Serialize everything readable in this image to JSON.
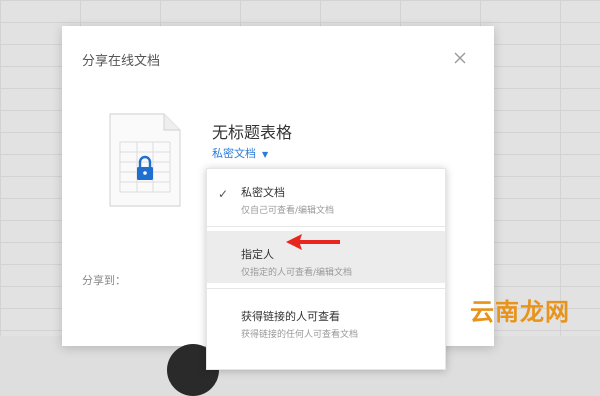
{
  "dialog": {
    "title": "分享在线文档",
    "doc_name": "无标题表格",
    "privacy_selected": "私密文档",
    "share_to_label": "分享到："
  },
  "dropdown": {
    "options": [
      {
        "label": "私密文档",
        "desc": "仅自己可查看/编辑文档",
        "checked": true
      },
      {
        "label": "指定人",
        "desc": "仅指定的人可查看/编辑文档",
        "highlighted": true
      },
      {
        "label": "获得链接的人可查看",
        "desc": "获得链接的任何人可查看文档"
      }
    ]
  },
  "annotation": {
    "arrow_color": "#e8251f"
  },
  "watermark": {
    "text": "云南龙网"
  },
  "colors": {
    "accent": "#2b7bd8",
    "lock": "#1f6fd0"
  }
}
